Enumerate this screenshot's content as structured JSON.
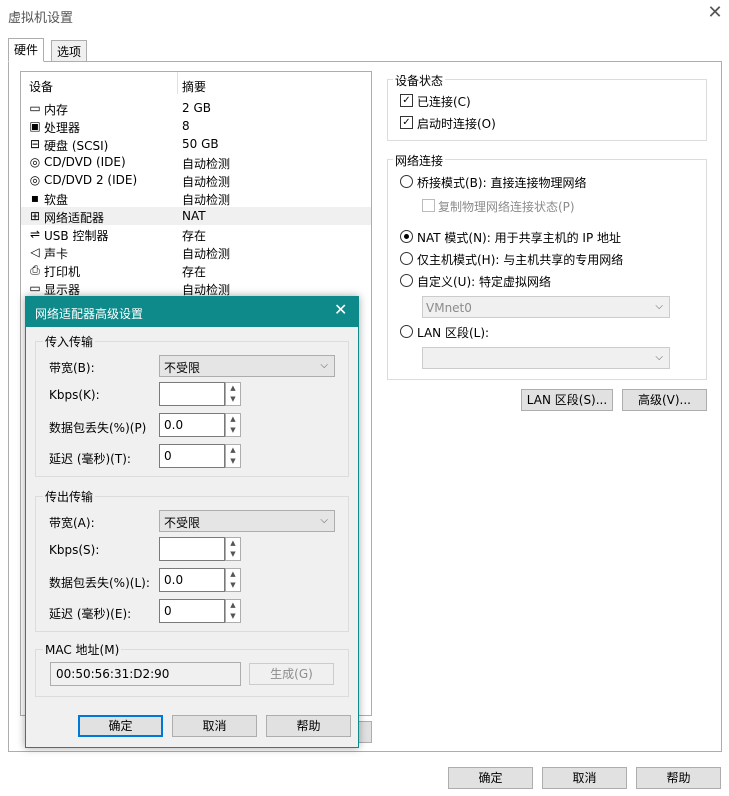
{
  "window": {
    "title": "虚拟机设置"
  },
  "tabs": [
    {
      "label": "硬件"
    },
    {
      "label": "选项"
    }
  ],
  "device_list": {
    "columns": [
      "设备",
      "摘要"
    ],
    "rows": [
      {
        "icon": "memory-icon",
        "name": "内存",
        "summary": "2 GB"
      },
      {
        "icon": "cpu-icon",
        "name": "处理器",
        "summary": "8"
      },
      {
        "icon": "harddisk-icon",
        "name": "硬盘 (SCSI)",
        "summary": "50 GB"
      },
      {
        "icon": "cd-dvd-icon",
        "name": "CD/DVD (IDE)",
        "summary": "自动检测"
      },
      {
        "icon": "cd-dvd-icon",
        "name": "CD/DVD 2 (IDE)",
        "summary": "自动检测"
      },
      {
        "icon": "floppy-icon",
        "name": "软盘",
        "summary": "自动检测"
      },
      {
        "icon": "network-adapter-icon",
        "name": "网络适配器",
        "summary": "NAT"
      },
      {
        "icon": "usb-icon",
        "name": "USB 控制器",
        "summary": "存在"
      },
      {
        "icon": "sound-icon",
        "name": "声卡",
        "summary": "自动检测"
      },
      {
        "icon": "printer-icon",
        "name": "打印机",
        "summary": "存在"
      },
      {
        "icon": "display-icon",
        "name": "显示器",
        "summary": "自动检测"
      }
    ]
  },
  "device_status": {
    "title": "设备状态",
    "connected_label": "已连接(C)",
    "connect_at_power_on_label": "启动时连接(O)"
  },
  "network": {
    "title": "网络连接",
    "bridged_label": "桥接模式(B): 直接连接物理网络",
    "replicate_label": "复制物理网络连接状态(P)",
    "nat_label": "NAT 模式(N): 用于共享主机的 IP 地址",
    "hostonly_label": "仅主机模式(H): 与主机共享的专用网络",
    "custom_label": "自定义(U): 特定虚拟网络",
    "custom_value": "VMnet0",
    "lan_label": "LAN 区段(L):",
    "selected": "nat"
  },
  "side_buttons": {
    "lan_segments": "LAN 区段(S)...",
    "advanced": "高级(V)..."
  },
  "footer": {
    "ok": "确定",
    "cancel": "取消",
    "help": "帮助"
  },
  "dialog": {
    "title": "网络适配器高级设置",
    "incoming": {
      "title": "传入传输",
      "bandwidth_label": "带宽(B):",
      "bandwidth_value": "不受限",
      "kbps_label": "Kbps(K):",
      "kbps_value": "",
      "loss_label": "数据包丢失(%)(P)",
      "loss_value": "0.0",
      "latency_label": "延迟 (毫秒)(T):",
      "latency_value": "0"
    },
    "outgoing": {
      "title": "传出传输",
      "bandwidth_label": "带宽(A):",
      "bandwidth_value": "不受限",
      "kbps_label": "Kbps(S):",
      "kbps_value": "",
      "loss_label": "数据包丢失(%)(L):",
      "loss_value": "0.0",
      "latency_label": "延迟 (毫秒)(E):",
      "latency_value": "0"
    },
    "mac": {
      "title": "MAC 地址(M)",
      "value": "00:50:56:31:D2:90",
      "generate_label": "生成(G)"
    },
    "buttons": {
      "ok": "确定",
      "cancel": "取消",
      "help": "帮助"
    }
  }
}
